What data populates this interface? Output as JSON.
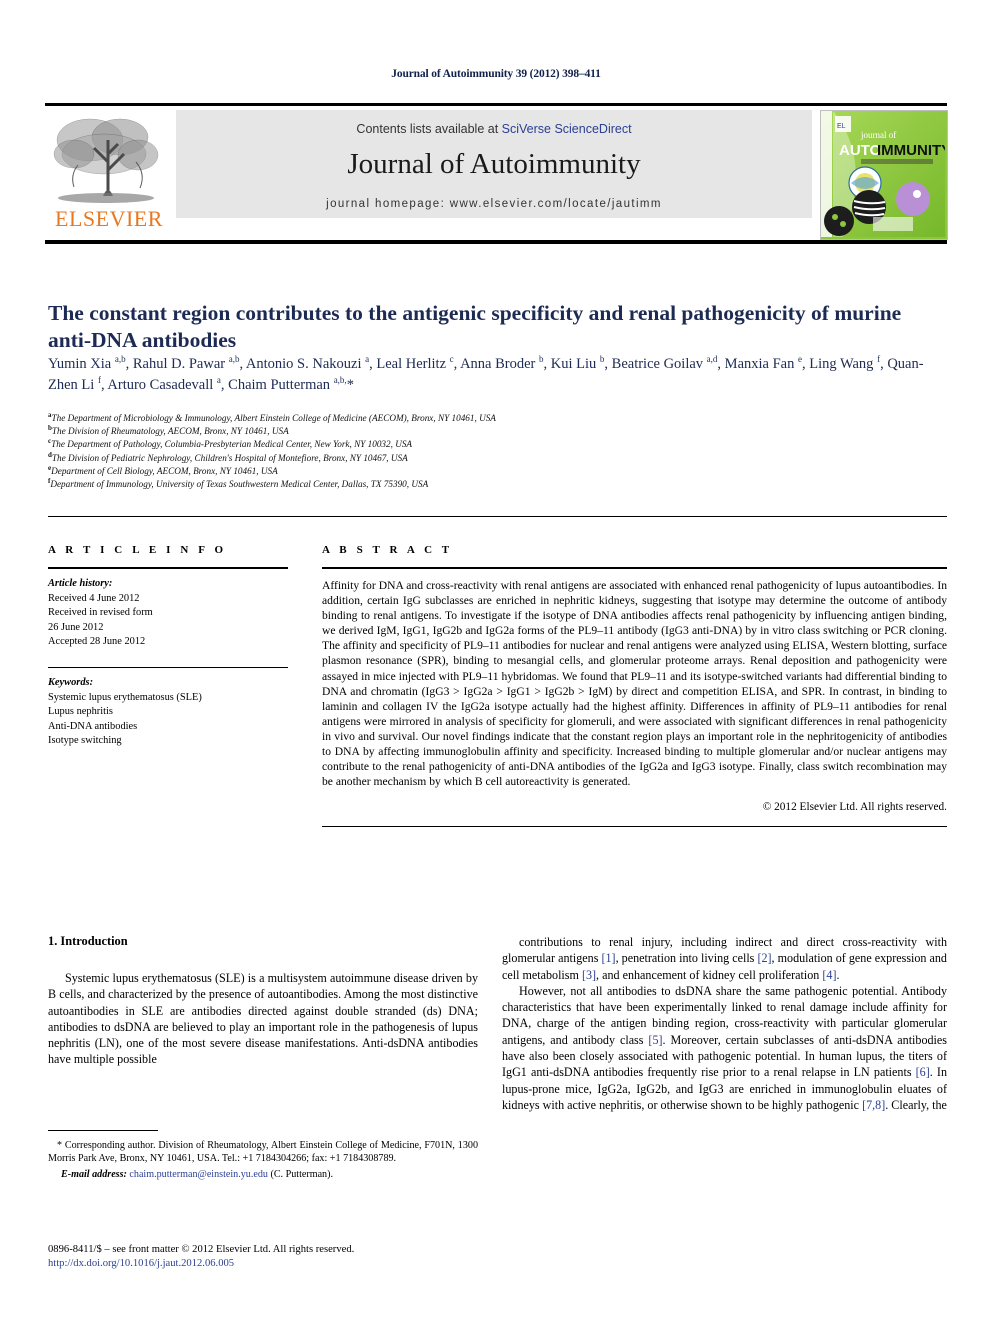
{
  "running_head": "Journal of Autoimmunity 39 (2012) 398–411",
  "masthead": {
    "contents_prefix": "Contents lists available at ",
    "sciencedirect_link": "SciVerse ScienceDirect",
    "journal_title": "Journal of Autoimmunity",
    "homepage": "journal homepage: www.elsevier.com/locate/jautimm",
    "publisher_logo_text": "ELSEVIER",
    "cover_title_line1": "journal of",
    "cover_title_line2": "AUTO",
    "cover_title_line3": "IMMUNITY"
  },
  "article": {
    "title": "The constant region contributes to the antigenic specificity and renal pathogenicity of murine anti-DNA antibodies",
    "authors_html": "Yumin Xia <sup>a,b</sup>, Rahul D. Pawar <sup>a,b</sup>, Antonio S. Nakouzi <sup>a</sup>, Leal Herlitz <sup>c</sup>, Anna Broder <sup>b</sup>, Kui Liu <sup>b</sup>, Beatrice Goilav <sup>a,d</sup>, Manxia Fan <sup>e</sup>, Ling Wang <sup>f</sup>, Quan-Zhen Li <sup>f</sup>, Arturo Casadevall <sup>a</sup>, Chaim Putterman <sup>a,b,</sup>*",
    "affiliations": [
      {
        "mark": "a",
        "text": "The Department of Microbiology & Immunology, Albert Einstein College of Medicine (AECOM), Bronx, NY 10461, USA"
      },
      {
        "mark": "b",
        "text": "The Division of Rheumatology, AECOM, Bronx, NY 10461, USA"
      },
      {
        "mark": "c",
        "text": "The Department of Pathology, Columbia-Presbyterian Medical Center, New York, NY 10032, USA"
      },
      {
        "mark": "d",
        "text": "The Division of Pediatric Nephrology, Children's Hospital of Montefiore, Bronx, NY 10467, USA"
      },
      {
        "mark": "e",
        "text": "Department of Cell Biology, AECOM, Bronx, NY 10461, USA"
      },
      {
        "mark": "f",
        "text": "Department of Immunology, University of Texas Southwestern Medical Center, Dallas, TX 75390, USA"
      }
    ]
  },
  "article_info": {
    "heading": "A R T I C L E  I N F O",
    "history_label": "Article history:",
    "history_lines": [
      "Received 4 June 2012",
      "Received in revised form",
      "26 June 2012",
      "Accepted 28 June 2012"
    ],
    "keywords_label": "Keywords:",
    "keywords": [
      "Systemic lupus erythematosus (SLE)",
      "Lupus nephritis",
      "Anti-DNA antibodies",
      "Isotype switching"
    ]
  },
  "abstract": {
    "heading": "A B S T R A C T",
    "text": "Affinity for DNA and cross-reactivity with renal antigens are associated with enhanced renal pathogenicity of lupus autoantibodies. In addition, certain IgG subclasses are enriched in nephritic kidneys, suggesting that isotype may determine the outcome of antibody binding to renal antigens. To investigate if the isotype of DNA antibodies affects renal pathogenicity by influencing antigen binding, we derived IgM, IgG1, IgG2b and IgG2a forms of the PL9–11 antibody (IgG3 anti-DNA) by in vitro class switching or PCR cloning. The affinity and specificity of PL9–11 antibodies for nuclear and renal antigens were analyzed using ELISA, Western blotting, surface plasmon resonance (SPR), binding to mesangial cells, and glomerular proteome arrays. Renal deposition and pathogenicity were assayed in mice injected with PL9–11 hybridomas. We found that PL9–11 and its isotype-switched variants had differential binding to DNA and chromatin (IgG3 > IgG2a > IgG1 > IgG2b > IgM) by direct and competition ELISA, and SPR. In contrast, in binding to laminin and collagen IV the IgG2a isotype actually had the highest affinity. Differences in affinity of PL9–11 antibodies for renal antigens were mirrored in analysis of specificity for glomeruli, and were associated with significant differences in renal pathogenicity in vivo and survival. Our novel findings indicate that the constant region plays an important role in the nephritogenicity of antibodies to DNA by affecting immunoglobulin affinity and specificity. Increased binding to multiple glomerular and/or nuclear antigens may contribute to the renal pathogenicity of anti-DNA antibodies of the IgG2a and IgG3 isotype. Finally, class switch recombination may be another mechanism by which B cell autoreactivity is generated.",
    "copyright": "© 2012 Elsevier Ltd. All rights reserved."
  },
  "introduction": {
    "heading": "1. Introduction",
    "left_paragraph_html": "Systemic lupus erythematosus (SLE) is a multisystem autoimmune disease driven by B cells, and characterized by the presence of autoantibodies. Among the most distinctive autoantibodies in SLE are antibodies directed against double stranded (ds) DNA; antibodies to dsDNA are believed to play an important role in the pathogenesis of lupus nephritis (LN), one of the most severe disease manifestations. Anti-dsDNA antibodies have multiple possible",
    "right_paragraph1_html": "contributions to renal injury, including indirect and direct cross-reactivity with glomerular antigens <span class=\"ref\">[1]</span>, penetration into living cells <span class=\"ref\">[2]</span>, modulation of gene expression and cell metabolism <span class=\"ref\">[3]</span>, and enhancement of kidney cell proliferation <span class=\"ref\">[4]</span>.",
    "right_paragraph2_html": "However, not all antibodies to dsDNA share the same pathogenic potential. Antibody characteristics that have been experimentally linked to renal damage include affinity for DNA, charge of the antigen binding region, cross-reactivity with particular glomerular antigens, and antibody class <span class=\"ref\">[5]</span>. Moreover, certain subclasses of anti-dsDNA antibodies have also been closely associated with pathogenic potential. In human lupus, the titers of IgG1 anti-dsDNA antibodies frequently rise prior to a renal relapse in LN patients <span class=\"ref\">[6]</span>. In lupus-prone mice, IgG2a, IgG2b, and IgG3 are enriched in immunoglobulin eluates of kidneys with active nephritis, or otherwise shown to be highly pathogenic <span class=\"ref\">[7,8]</span>. Clearly, the"
  },
  "footnote": {
    "corresponding_html": "* Corresponding author. Division of Rheumatology, Albert Einstein College of Medicine, F701N, 1300 Morris Park Ave, Bronx, NY 10461, USA. Tel.: +1 7184304266; fax: +1 7184308789.",
    "email_label": "E-mail address:",
    "email_link": "chaim.putterman@einstein.yu.edu",
    "email_suffix": " (C. Putterman)."
  },
  "issn_line": "0896-8411/$ – see front matter © 2012 Elsevier Ltd. All rights reserved.",
  "doi_line": "http://dx.doi.org/10.1016/j.jaut.2012.06.005",
  "colors": {
    "title_blue": "#1d2b54",
    "link_blue": "#2b3f93",
    "elsevier_orange": "#E87722",
    "masthead_gray": "#e6e6e6",
    "cover_green": "#8dc63f"
  }
}
